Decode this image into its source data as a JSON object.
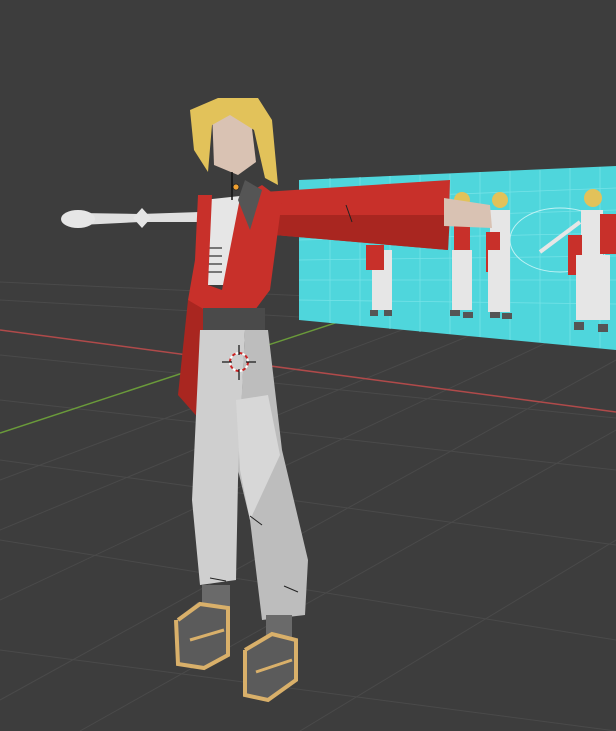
{
  "app": "3D viewport",
  "viewport": {
    "grid": true,
    "background_color": "#3d3d3d",
    "grid_color": "#4a4a4a",
    "x_axis_color": "#b04a4a",
    "y_axis_color": "#6a9a3a"
  },
  "scene": {
    "model": "character-in-t-pose",
    "reference_image": "character-turnaround-sheet",
    "reference_background_color": "#4fd6dc",
    "jacket_color": "#c8302a",
    "hair_color": "#e2c25a",
    "pants_color": "#cfcfcf",
    "skin_color": "#d9c2b3",
    "shoe_color": "#5b5b5b",
    "shoe_trim_color": "#d9b06a"
  },
  "icons": {
    "cursor": "3d-cursor-icon",
    "origin": "object-origin-icon",
    "bone": "armature-bone-icon"
  }
}
